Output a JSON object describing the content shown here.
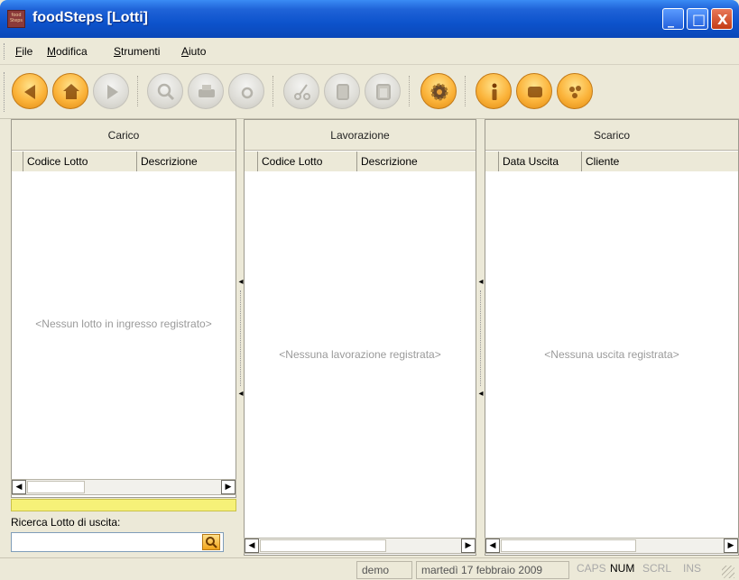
{
  "window": {
    "title": "foodSteps [Lotti]",
    "icon_text": "food Steps",
    "minimize_symbol": "_",
    "maximize_symbol": "□",
    "close_symbol": "X"
  },
  "menu": {
    "items": [
      "File",
      "Modifica",
      "Strumenti",
      "Aiuto"
    ]
  },
  "toolbar": {
    "buttons": [
      {
        "icon": "back-arrow-icon",
        "enabled": true
      },
      {
        "icon": "home-icon",
        "enabled": true
      },
      {
        "icon": "forward-arrow-icon",
        "enabled": false
      },
      {
        "icon": "search-icon",
        "enabled": false
      },
      {
        "icon": "print-icon",
        "enabled": false
      },
      {
        "icon": "preview-icon",
        "enabled": false
      },
      {
        "icon": "cut-icon",
        "enabled": false
      },
      {
        "icon": "copy-icon",
        "enabled": false
      },
      {
        "icon": "paste-icon",
        "enabled": false
      },
      {
        "icon": "settings-gear-icon",
        "enabled": true
      },
      {
        "icon": "info-icon",
        "enabled": true
      },
      {
        "icon": "book-icon",
        "enabled": true
      },
      {
        "icon": "palette-icon",
        "enabled": true
      }
    ],
    "colors": {
      "enabled": "#F9B13A",
      "disabled": "#DDDCD6"
    }
  },
  "panels": {
    "carico": {
      "title": "Carico",
      "columns": [
        "Codice Lotto",
        "Descrizione"
      ],
      "empty_message": "<Nessun lotto in ingresso registrato>"
    },
    "lavorazione": {
      "title": "Lavorazione",
      "columns": [
        "Codice Lotto",
        "Descrizione"
      ],
      "empty_message": "<Nessuna lavorazione registrata>"
    },
    "scarico": {
      "title": "Scarico",
      "columns": [
        "Data Uscita",
        "Cliente"
      ],
      "empty_message": "<Nessuna uscita registrata>"
    }
  },
  "search": {
    "label": "Ricerca Lotto di uscita:",
    "value": ""
  },
  "status": {
    "user": "demo",
    "date": "martedì 17 febbraio 2009",
    "keys": [
      "CAPS",
      "NUM",
      "SCRL",
      "INS"
    ]
  }
}
